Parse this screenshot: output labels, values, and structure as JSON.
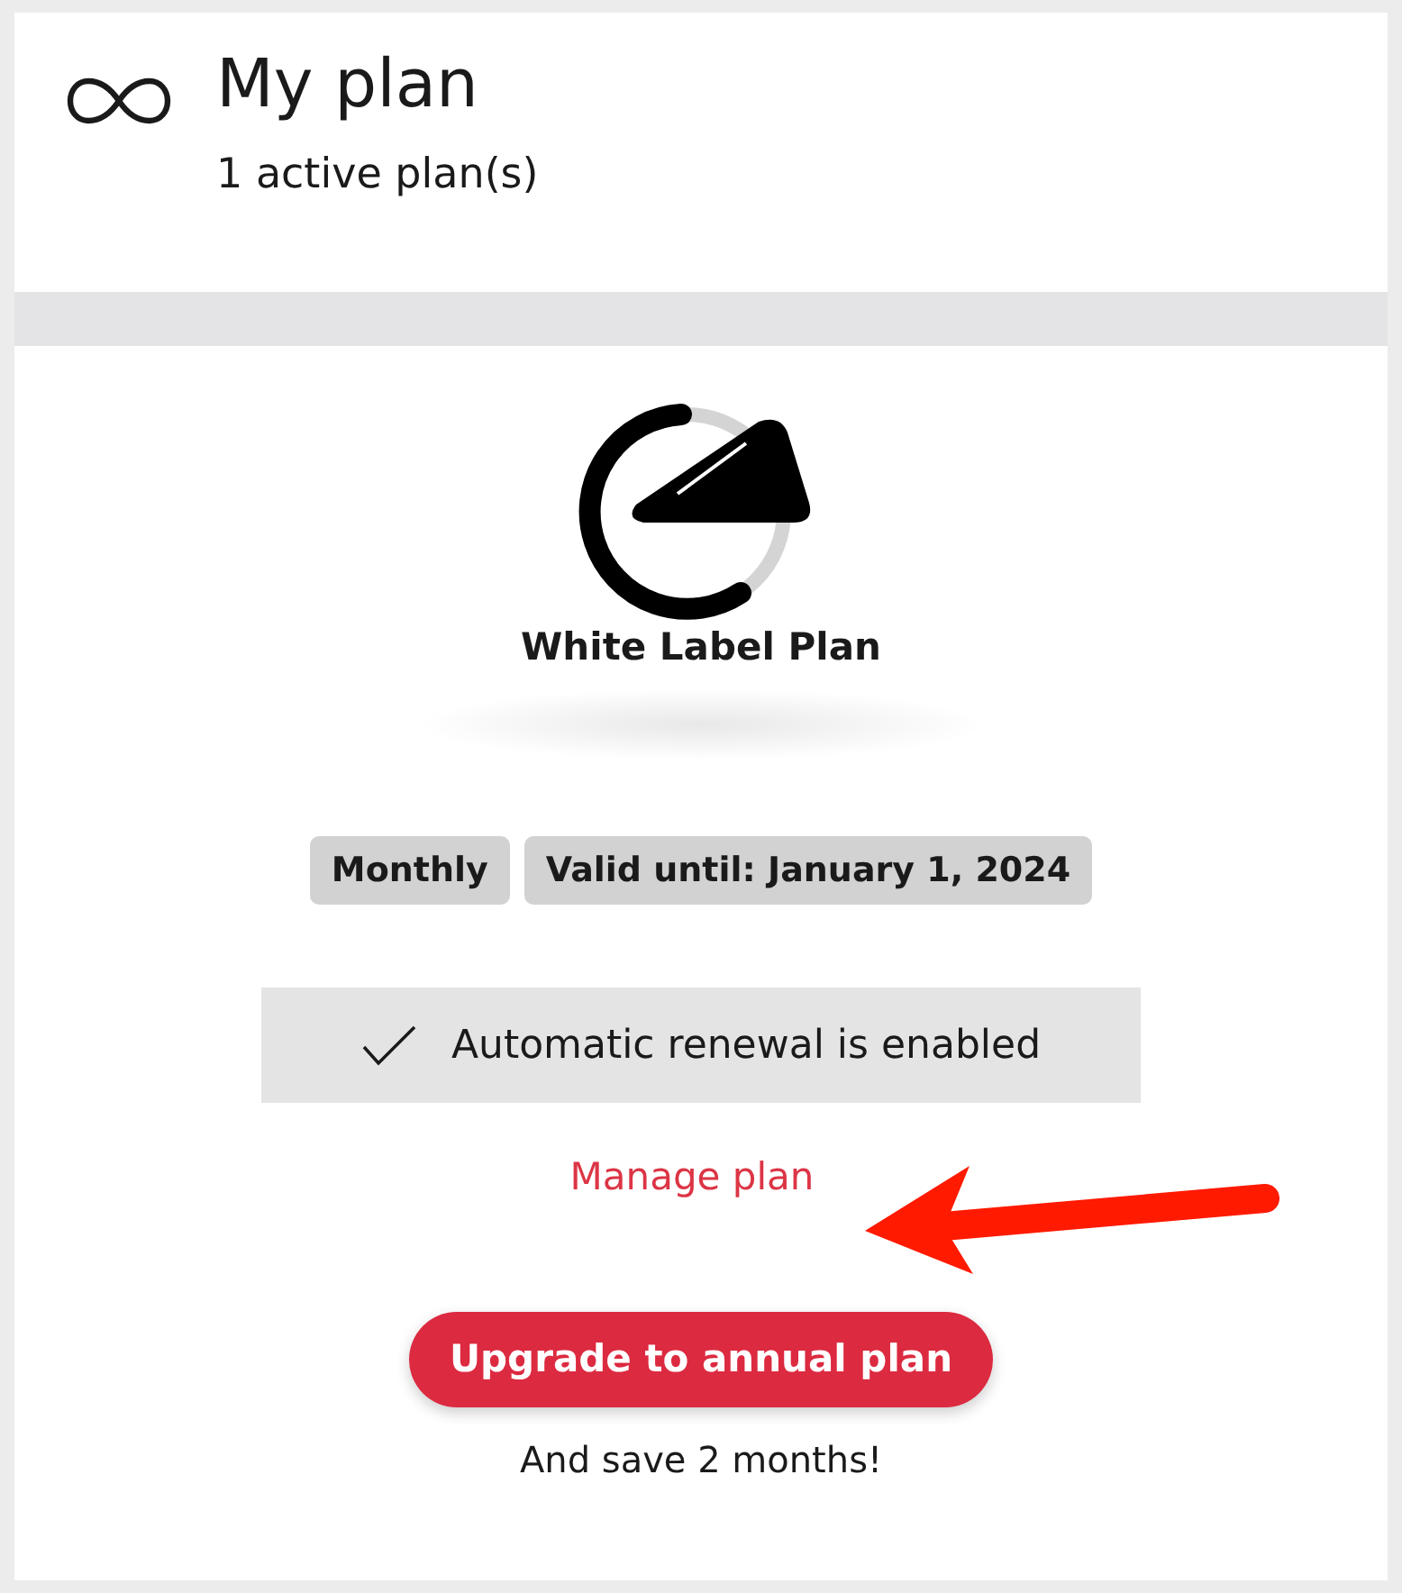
{
  "header": {
    "title": "My plan",
    "subtitle": "1 active plan(s)"
  },
  "plan": {
    "name": "White Label Plan",
    "tags": [
      "Monthly",
      "Valid until: January 1, 2024"
    ]
  },
  "renewal": {
    "text": "Automatic renewal is enabled",
    "enabled": true
  },
  "manage_link": "Manage plan",
  "upgrade_button": "Upgrade to annual plan",
  "note": "And save 2 months!"
}
